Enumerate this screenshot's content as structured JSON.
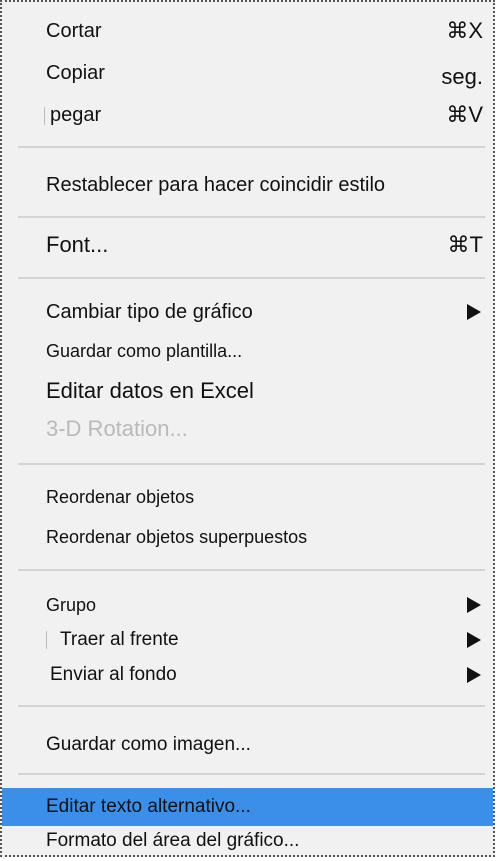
{
  "menu": {
    "cut_label": "Cortar",
    "cut_shortcut": "⌘X",
    "copy_label": "Copiar",
    "copy_shortcut": "seg.",
    "paste_label": "pegar",
    "paste_shortcut": "⌘V",
    "reset_style_label": "Restablecer para hacer coincidir estilo",
    "font_label": "Font...",
    "font_shortcut": "⌘T",
    "change_chart_type_label": "Cambiar tipo de gráfico",
    "save_template_label": "Guardar como plantilla...",
    "edit_data_excel_label": "Editar datos en Excel",
    "rotation_3d_label": "3-D Rotation...",
    "reorder_objects_label": "Reordenar objetos",
    "reorder_overlapping_label": "Reordenar objetos superpuestos",
    "group_label": "Grupo",
    "bring_front_label": "Traer al frente",
    "send_back_label": "Enviar al fondo",
    "save_as_image_label": "Guardar como imagen...",
    "edit_alt_text_label": "Editar texto alternativo...",
    "format_chart_area_label": "Formato del área del gráfico..."
  },
  "colors": {
    "menu_background": "#f1f1f1",
    "highlight": "#3b8fe8",
    "disabled_text": "#b9b9b9",
    "separator": "#d4d4d4"
  }
}
